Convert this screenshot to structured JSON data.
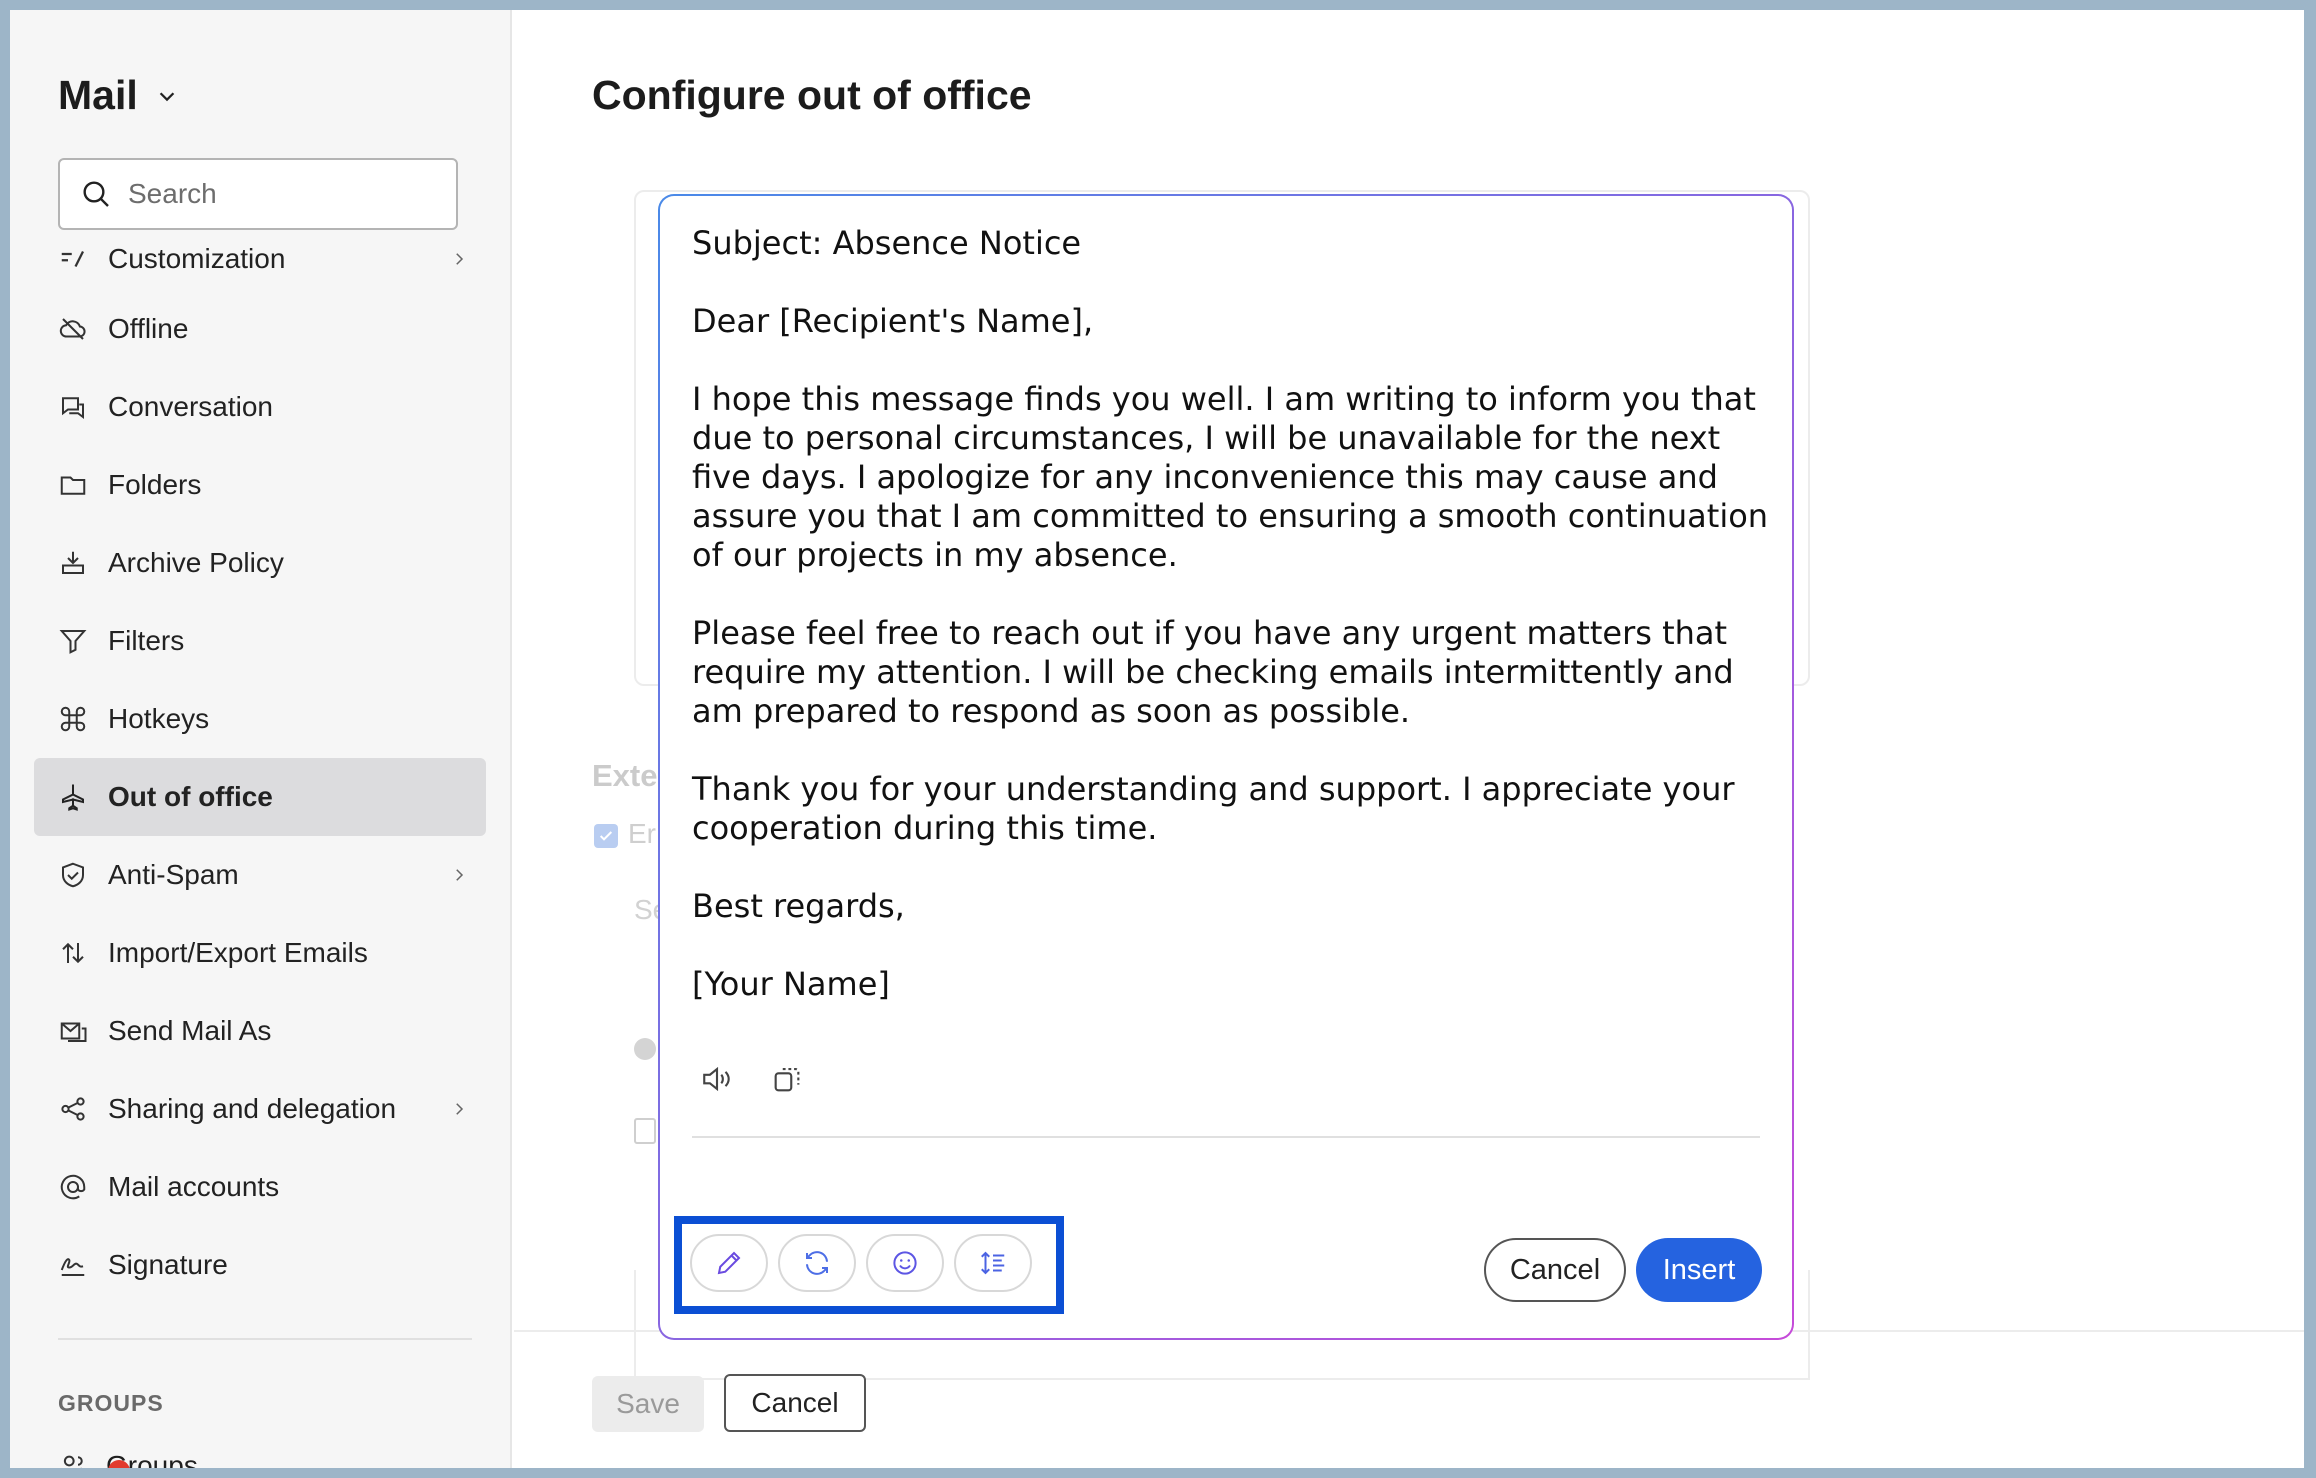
{
  "sidebar": {
    "app_title": "Mail",
    "search_placeholder": "Search",
    "items": [
      {
        "label": "Customization",
        "icon": "customization-icon",
        "has_arrow": true
      },
      {
        "label": "Offline",
        "icon": "cloud-off-icon"
      },
      {
        "label": "Conversation",
        "icon": "conversation-icon"
      },
      {
        "label": "Folders",
        "icon": "folder-icon"
      },
      {
        "label": "Archive Policy",
        "icon": "archive-icon"
      },
      {
        "label": "Filters",
        "icon": "filter-icon"
      },
      {
        "label": "Hotkeys",
        "icon": "command-icon"
      },
      {
        "label": "Out of office",
        "icon": "airplane-icon",
        "active": true
      },
      {
        "label": "Anti-Spam",
        "icon": "shield-icon",
        "has_arrow": true
      },
      {
        "label": "Import/Export Emails",
        "icon": "import-export-icon"
      },
      {
        "label": "Send Mail As",
        "icon": "send-as-icon"
      },
      {
        "label": "Sharing and delegation",
        "icon": "share-icon",
        "has_arrow": true
      },
      {
        "label": "Mail accounts",
        "icon": "at-icon"
      },
      {
        "label": "Signature",
        "icon": "signature-icon"
      }
    ],
    "groups_label": "GROUPS",
    "groups_item": "Groups"
  },
  "main": {
    "title": "Configure out of office",
    "ext_heading": "Exte",
    "ext_check_label": "Er",
    "faint_label": "Se",
    "save_label": "Save",
    "cancel_label": "Cancel"
  },
  "popup": {
    "subject": "Subject: Absence Notice",
    "greeting": "Dear [Recipient's Name],",
    "para1": "I hope this message finds you well. I am writing to inform you that due to personal circumstances, I will be unavailable for the next five days. I apologize for any inconvenience this may cause and assure you that I am committed to ensuring a smooth continuation of our projects in my absence.",
    "para2": "Please feel free to reach out if you have any urgent matters that require my attention. I will be checking emails intermittently and am prepared to respond as soon as possible.",
    "para3": "Thank you for your understanding and support. I appreciate your cooperation during this time.",
    "closing": "Best regards,",
    "signature": "[Your Name]",
    "tools": [
      "speaker-icon",
      "copy-icon"
    ],
    "ai_actions": [
      "pencil-icon",
      "regenerate-icon",
      "emoji-icon",
      "line-spacing-icon"
    ],
    "cancel_label": "Cancel",
    "insert_label": "Insert",
    "accent_color": "#2563e0",
    "highlight_color": "#0b4fd4"
  }
}
